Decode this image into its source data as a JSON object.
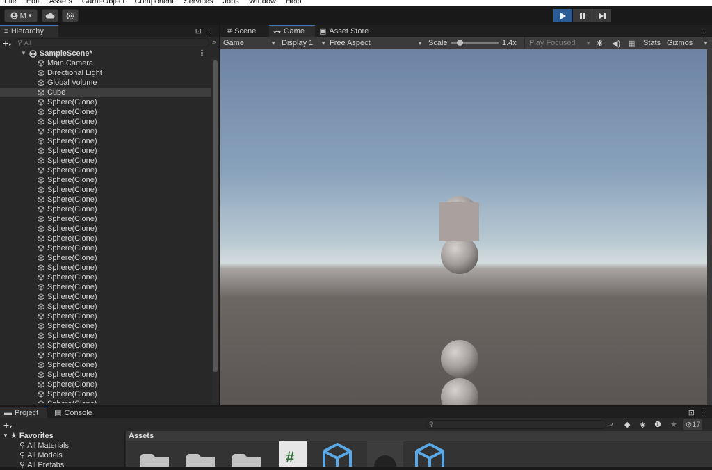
{
  "menu": [
    "File",
    "Edit",
    "Assets",
    "GameObject",
    "Component",
    "Services",
    "Jobs",
    "Window",
    "Help"
  ],
  "toolbar": {
    "account_label": "M",
    "account_dropdown": "▾"
  },
  "hierarchy": {
    "tab_label": "Hierarchy",
    "search_placeholder": "All",
    "scene_name": "SampleScene*",
    "items": [
      {
        "label": "Main Camera",
        "selected": false
      },
      {
        "label": "Directional Light",
        "selected": false
      },
      {
        "label": "Global Volume",
        "selected": false
      },
      {
        "label": "Cube",
        "selected": true
      },
      {
        "label": "Sphere(Clone)"
      },
      {
        "label": "Sphere(Clone)"
      },
      {
        "label": "Sphere(Clone)"
      },
      {
        "label": "Sphere(Clone)"
      },
      {
        "label": "Sphere(Clone)"
      },
      {
        "label": "Sphere(Clone)"
      },
      {
        "label": "Sphere(Clone)"
      },
      {
        "label": "Sphere(Clone)"
      },
      {
        "label": "Sphere(Clone)"
      },
      {
        "label": "Sphere(Clone)"
      },
      {
        "label": "Sphere(Clone)"
      },
      {
        "label": "Sphere(Clone)"
      },
      {
        "label": "Sphere(Clone)"
      },
      {
        "label": "Sphere(Clone)"
      },
      {
        "label": "Sphere(Clone)"
      },
      {
        "label": "Sphere(Clone)"
      },
      {
        "label": "Sphere(Clone)"
      },
      {
        "label": "Sphere(Clone)"
      },
      {
        "label": "Sphere(Clone)"
      },
      {
        "label": "Sphere(Clone)"
      },
      {
        "label": "Sphere(Clone)"
      },
      {
        "label": "Sphere(Clone)"
      },
      {
        "label": "Sphere(Clone)"
      },
      {
        "label": "Sphere(Clone)"
      },
      {
        "label": "Sphere(Clone)"
      },
      {
        "label": "Sphere(Clone)"
      },
      {
        "label": "Sphere(Clone)"
      },
      {
        "label": "Sphere(Clone)"
      },
      {
        "label": "Sphere(Clone)"
      },
      {
        "label": "Sphere(Clone)"
      },
      {
        "label": "Sphere(Clone)"
      },
      {
        "label": "Sphere(Clone)"
      }
    ]
  },
  "view_tabs": {
    "scene": "Scene",
    "game": "Game",
    "asset_store": "Asset Store"
  },
  "game_toolbar": {
    "mode": "Game",
    "display": "Display 1",
    "aspect": "Free Aspect",
    "scale_label": "Scale",
    "scale_value": "1.4x",
    "scale_fraction": 0.12,
    "play_focused": "Play Focused",
    "stats": "Stats",
    "gizmos": "Gizmos"
  },
  "bottom": {
    "project_tab": "Project",
    "console_tab": "Console",
    "favorites": "Favorites",
    "fav_items": [
      "All Materials",
      "All Models",
      "All Prefabs"
    ],
    "assets_header": "Assets",
    "hidden_count": "17"
  },
  "colors": {
    "accent": "#2a5d96",
    "selection": "#3e3e3e",
    "panel": "#282828",
    "sky_top": "#6f86a6",
    "horizon": "#cfd9dd",
    "ground": "#5f5a57"
  }
}
